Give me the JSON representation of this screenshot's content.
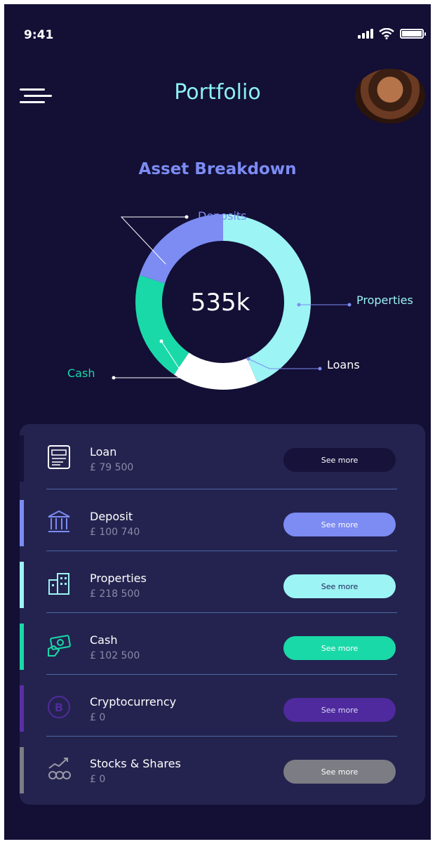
{
  "status_bar": {
    "time": "9:41"
  },
  "header": {
    "title": "Portfolio"
  },
  "breakdown": {
    "title": "Asset Breakdown",
    "total": "535k"
  },
  "chart_data": {
    "type": "pie",
    "categories": [
      "Deposits",
      "Properties",
      "Loans",
      "Cash"
    ],
    "values": [
      100740,
      218500,
      79500,
      102500
    ],
    "colors": [
      "#7c8cf3",
      "#9cf4f4",
      "#ffffff",
      "#1ad9a8"
    ],
    "center_label": "535k"
  },
  "assets": [
    {
      "name": "Loan",
      "amount": "£ 79 500",
      "button": "See more",
      "icon": "loan-document-icon",
      "accent": "#16123a",
      "btn_bg": "#16123a",
      "btn_fg": "#ffffff"
    },
    {
      "name": "Deposit",
      "amount": "£ 100 740",
      "button": "See more",
      "icon": "bank-icon",
      "accent": "#7c8cf3",
      "btn_bg": "#7c8cf3",
      "btn_fg": "#ffffff"
    },
    {
      "name": "Properties",
      "amount": "£ 218 500",
      "button": "See more",
      "icon": "buildings-icon",
      "accent": "#9cf4f4",
      "btn_bg": "#9cf4f4",
      "btn_fg": "#1f1f5a"
    },
    {
      "name": "Cash",
      "amount": "£ 102 500",
      "button": "See more",
      "icon": "cash-icon",
      "accent": "#1ad9a8",
      "btn_bg": "#1ad9a8",
      "btn_fg": "#ffffff"
    },
    {
      "name": "Cryptocurrency",
      "amount": "£ 0",
      "button": "See more",
      "icon": "bitcoin-icon",
      "accent": "#5a2fa6",
      "btn_bg": "#4f2a9e",
      "btn_fg": "#d9d9f5"
    },
    {
      "name": "Stocks & Shares",
      "amount": "£ 0",
      "button": "See more",
      "icon": "stocks-icon",
      "accent": "#7c7c84",
      "btn_bg": "#7c7c84",
      "btn_fg": "#ffffff"
    }
  ]
}
